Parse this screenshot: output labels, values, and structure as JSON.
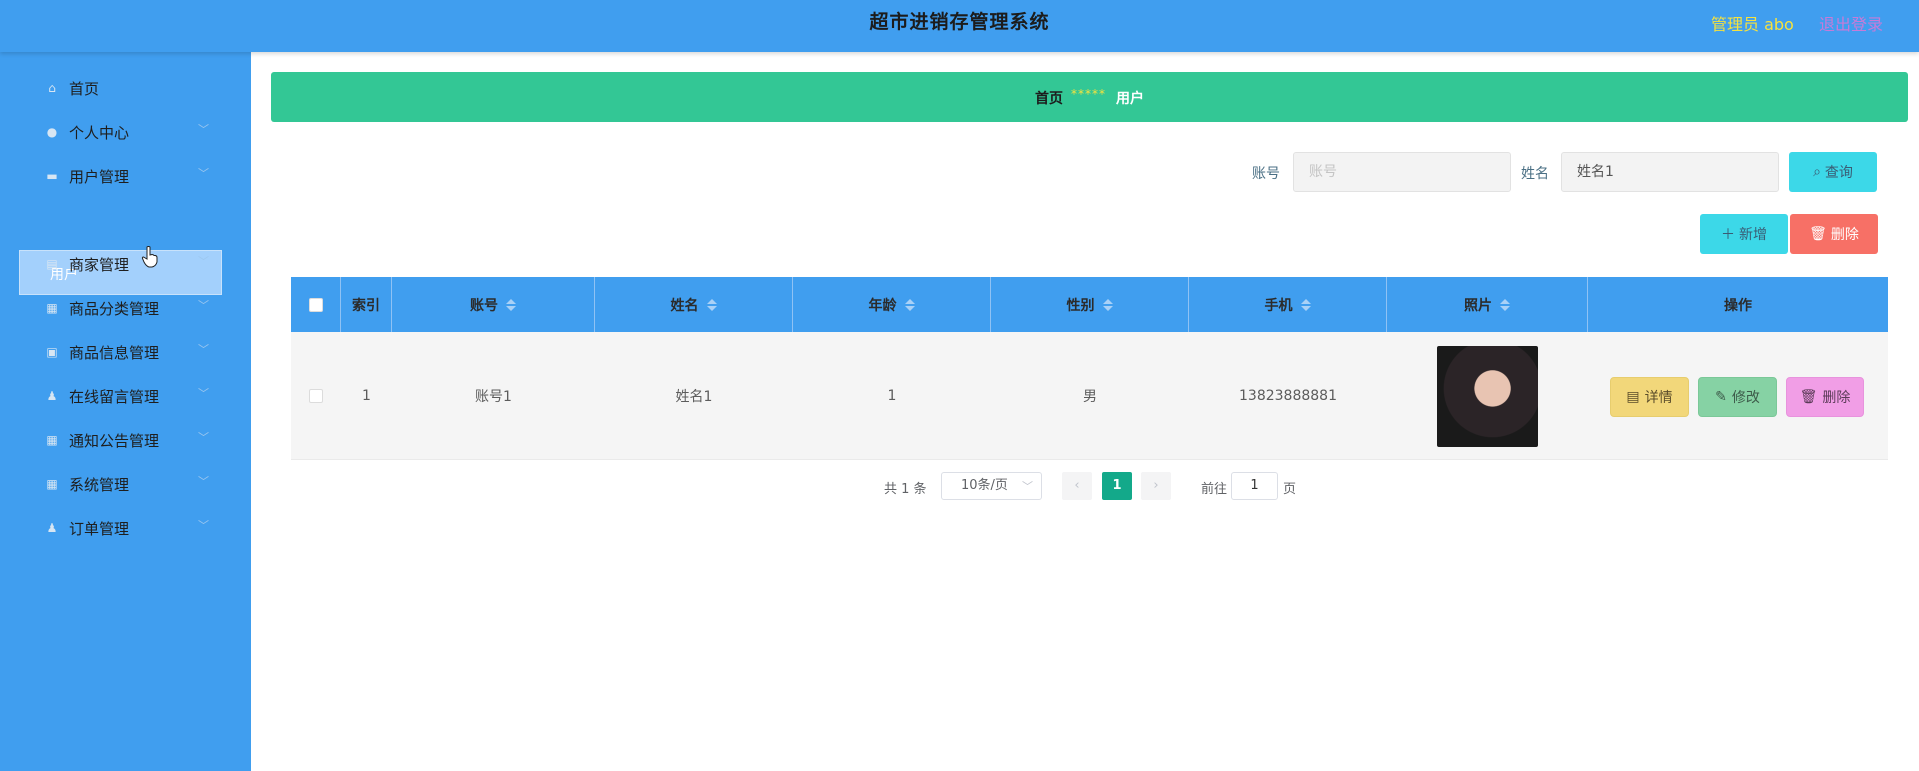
{
  "header": {
    "title": "超市进销存管理系统",
    "user": "管理员 abo",
    "logout": "退出登录"
  },
  "sidebar": {
    "items": [
      {
        "label": "首页",
        "icon": "home-icon"
      },
      {
        "label": "个人中心",
        "icon": "user-icon"
      },
      {
        "label": "用户管理",
        "icon": "monitor-icon"
      },
      {
        "label": "商家管理",
        "icon": "clipboard-icon"
      },
      {
        "label": "商品分类管理",
        "icon": "grid-icon"
      },
      {
        "label": "商品信息管理",
        "icon": "folder-icon"
      },
      {
        "label": "在线留言管理",
        "icon": "person-icon"
      },
      {
        "label": "通知公告管理",
        "icon": "grid-icon"
      },
      {
        "label": "系统管理",
        "icon": "grid-icon"
      },
      {
        "label": "订单管理",
        "icon": "person-icon"
      }
    ],
    "active_sub": "用户"
  },
  "breadcrumb": {
    "home": "首页",
    "separator": "*****",
    "current": "用户"
  },
  "search": {
    "account_label": "账号",
    "account_placeholder": "账号",
    "name_label": "姓名",
    "name_value": "姓名1",
    "query_button": "查询"
  },
  "toolbar": {
    "add_button": "新增",
    "delete_button": "删除"
  },
  "table": {
    "columns": [
      "索引",
      "账号",
      "姓名",
      "年龄",
      "性别",
      "手机",
      "照片",
      "操作"
    ],
    "rows": [
      {
        "index": "1",
        "account": "账号1",
        "name": "姓名1",
        "age": "1",
        "gender": "男",
        "phone": "13823888881"
      }
    ],
    "actions": {
      "detail": "详情",
      "edit": "修改",
      "delete": "删除"
    }
  },
  "pagination": {
    "total": "共 1 条",
    "page_size": "10条/页",
    "current_page": "1",
    "goto_label": "前往",
    "goto_value": "1",
    "page_suffix": "页"
  },
  "colors": {
    "header_bg": "#409eef",
    "breadcrumb_bg": "#33c795",
    "accent_cyan": "#3cd8e8",
    "danger": "#f77066",
    "page_active": "#13a98a"
  }
}
